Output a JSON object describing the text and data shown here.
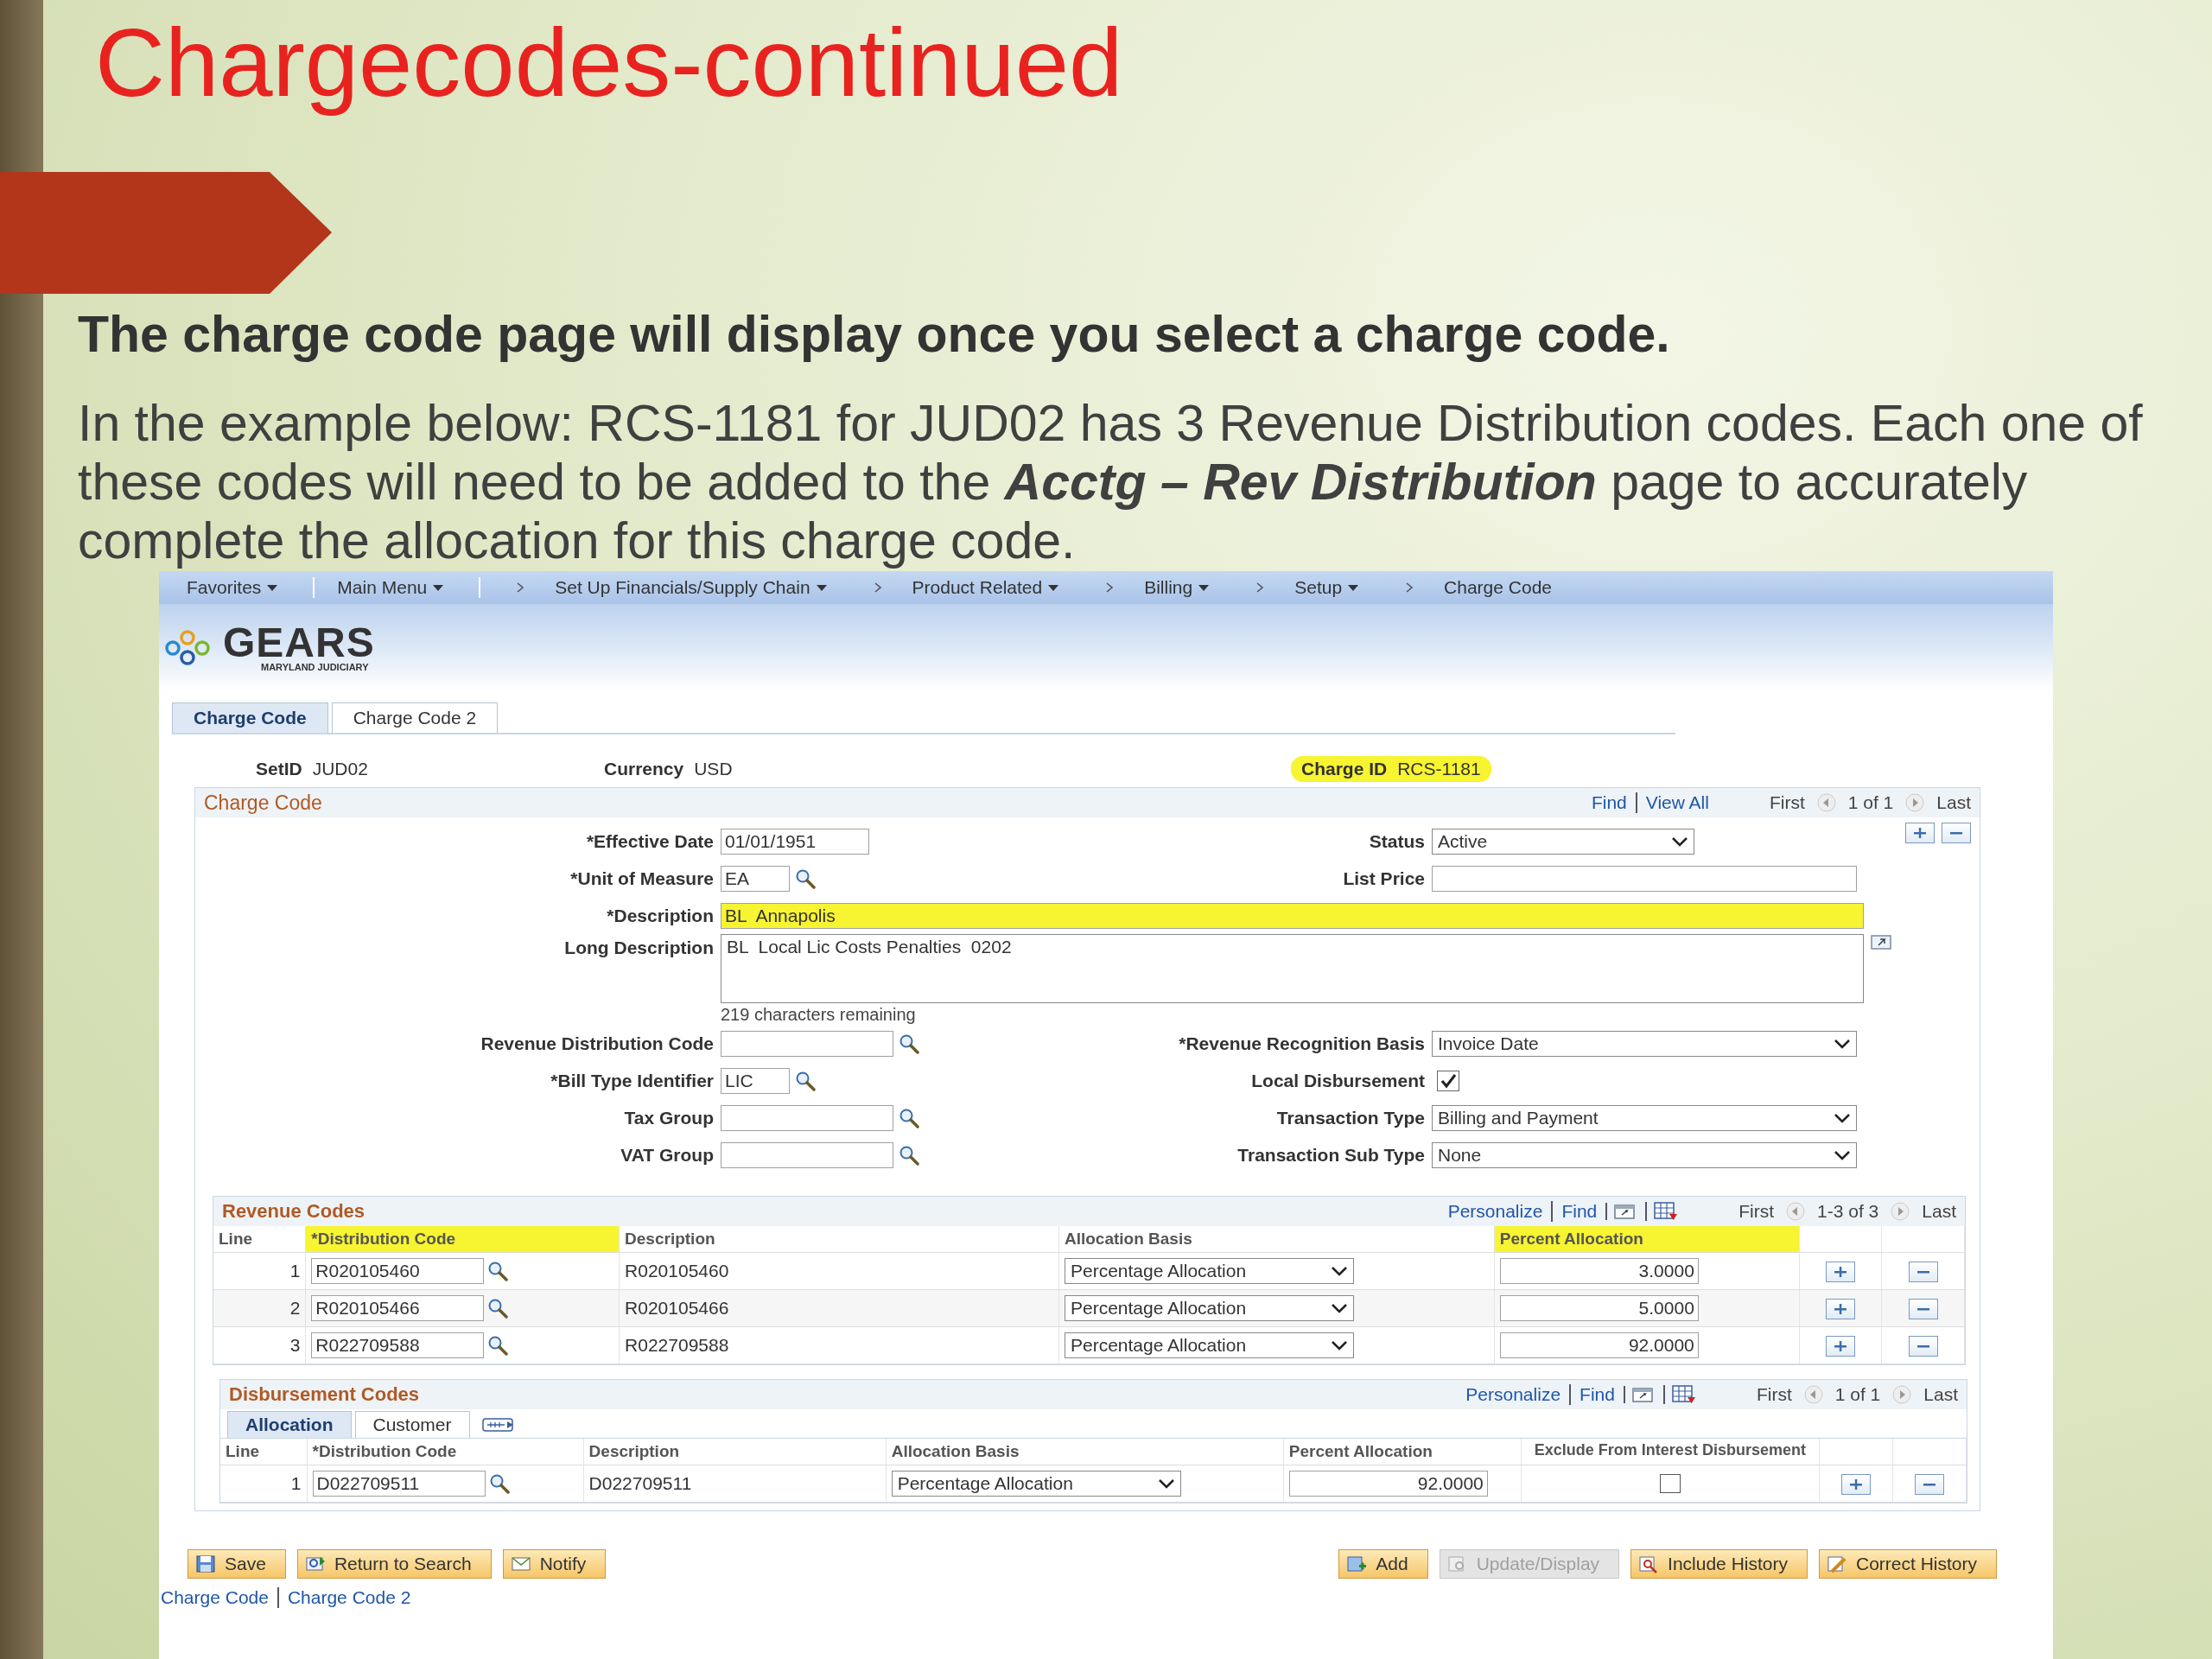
{
  "slide": {
    "title": "Chargecodes-continued",
    "heading": "The charge code page will display once you select a charge code.",
    "paragraph": "In the example below: RCS-1181 for JUD02 has 3 Revenue Distribution codes. Each one of these codes will need to be added to the **Acctg – Rev Distribution** page to accurately complete the allocation for this charge code."
  },
  "app": {
    "nav": [
      {
        "label": "Favorites",
        "kind": "menu"
      },
      {
        "label": "Main Menu",
        "kind": "menu"
      },
      {
        "label": "Set Up Financials/Supply Chain",
        "kind": "path_menu"
      },
      {
        "label": "Product Related",
        "kind": "path_menu"
      },
      {
        "label": "Billing",
        "kind": "path_menu"
      },
      {
        "label": "Setup",
        "kind": "path_menu"
      },
      {
        "label": "Charge Code",
        "kind": "path_page"
      }
    ],
    "logo": {
      "name": "GEARS",
      "subtitle": "MARYLAND JUDICIARY"
    },
    "tabs": [
      {
        "label": "Charge Code",
        "selected": true
      },
      {
        "label": "Charge Code 2",
        "selected": false
      }
    ],
    "key_fields": [
      {
        "label": "SetID",
        "value": "JUD02",
        "highlighted": false
      },
      {
        "label": "Currency",
        "value": "USD",
        "highlighted": false
      },
      {
        "label": "Charge ID",
        "value": "RCS-1181",
        "highlighted": true
      }
    ],
    "charge_code": {
      "title": "Charge Code",
      "links": [
        "Find",
        "View All"
      ],
      "first": "First",
      "count": "1 of 1",
      "last": "Last",
      "rows": [
        {
          "left": {
            "label": "*Effective Date",
            "kind": "date",
            "value": "01/01/1951"
          },
          "right": {
            "label": "Status",
            "kind": "short_select",
            "value": "Active"
          }
        },
        {
          "left": {
            "label": "*Unit of Measure",
            "kind": "short_lookup",
            "value": "EA"
          },
          "right": {
            "label": "List Price",
            "kind": "text"
          }
        },
        {
          "wide": {
            "label": "*Description",
            "kind": "text",
            "value": "BL  Annapolis",
            "highlighted": true
          }
        },
        {
          "wide": {
            "label": "Long Description",
            "kind": "textarea",
            "value": "BL  Local Lic Costs Penalties  0202",
            "note": "219 characters remaining",
            "highlighted": false
          }
        },
        {
          "left": {
            "label": "Revenue Distribution Code",
            "kind": "lookup"
          },
          "right": {
            "label": "*Revenue Recognition Basis",
            "kind": "select",
            "value": "Invoice Date"
          }
        },
        {
          "left": {
            "label": "*Bill Type Identifier",
            "kind": "short_lookup",
            "value": "LIC"
          },
          "right": {
            "label": "Local Disbursement",
            "kind": "checkbox",
            "checked": true
          }
        },
        {
          "left": {
            "label": "Tax Group",
            "kind": "lookup"
          },
          "right": {
            "label": "Transaction Type",
            "kind": "select",
            "value": "Billing and Payment"
          }
        },
        {
          "left": {
            "label": "VAT Group",
            "kind": "lookup"
          },
          "right": {
            "label": "Transaction Sub Type",
            "kind": "select",
            "value": "None"
          }
        }
      ]
    },
    "revenue_codes": {
      "title": "Revenue Codes",
      "links": [
        "Personalize",
        "Find"
      ],
      "first": "First",
      "count": "1-3 of 3",
      "last": "Last",
      "columns": [
        {
          "label": "Line",
          "highlighted": false
        },
        {
          "label": "*Distribution Code",
          "highlighted": true
        },
        {
          "label": "Description",
          "highlighted": false
        },
        {
          "label": "Allocation Basis",
          "highlighted": false
        },
        {
          "label": "Percent Allocation",
          "highlighted": true
        }
      ],
      "rows": [
        {
          "line": "1",
          "code": "R020105460",
          "description": "R020105460",
          "basis": "Percentage Allocation",
          "percent": "3.0000"
        },
        {
          "line": "2",
          "code": "R020105466",
          "description": "R020105466",
          "basis": "Percentage Allocation",
          "percent": "5.0000"
        },
        {
          "line": "3",
          "code": "R022709588",
          "description": "R022709588",
          "basis": "Percentage Allocation",
          "percent": "92.0000"
        }
      ]
    },
    "disbursement_codes": {
      "title": "Disbursement Codes",
      "links": [
        "Personalize",
        "Find"
      ],
      "first": "First",
      "count": "1 of 1",
      "last": "Last",
      "tabs": [
        {
          "label": "Allocation",
          "selected": true
        },
        {
          "label": "Customer",
          "selected": false
        }
      ],
      "columns": [
        {
          "label": "Line"
        },
        {
          "label": "*Distribution Code"
        },
        {
          "label": "Description"
        },
        {
          "label": "Allocation Basis"
        },
        {
          "label": "Percent Allocation"
        },
        {
          "label": "Exclude From Interest Disbursement"
        }
      ],
      "rows": [
        {
          "line": "1",
          "code": "D022709511",
          "description": "D022709511",
          "basis": "Percentage Allocation",
          "percent": "92.0000",
          "exclude": false
        }
      ]
    },
    "buttons": [
      {
        "label": "Save",
        "kind": "save",
        "disabled": false
      },
      {
        "label": "Return to Search",
        "kind": "return",
        "disabled": false
      },
      {
        "label": "Notify",
        "kind": "notify",
        "disabled": false
      },
      {
        "label": "Add",
        "kind": "add",
        "disabled": false
      },
      {
        "label": "Update/Display",
        "kind": "update",
        "disabled": true
      },
      {
        "label": "Include History",
        "kind": "include",
        "disabled": false
      },
      {
        "label": "Correct History",
        "kind": "correct",
        "disabled": false
      }
    ],
    "footer_links": [
      "Charge Code",
      "Charge Code 2"
    ]
  }
}
